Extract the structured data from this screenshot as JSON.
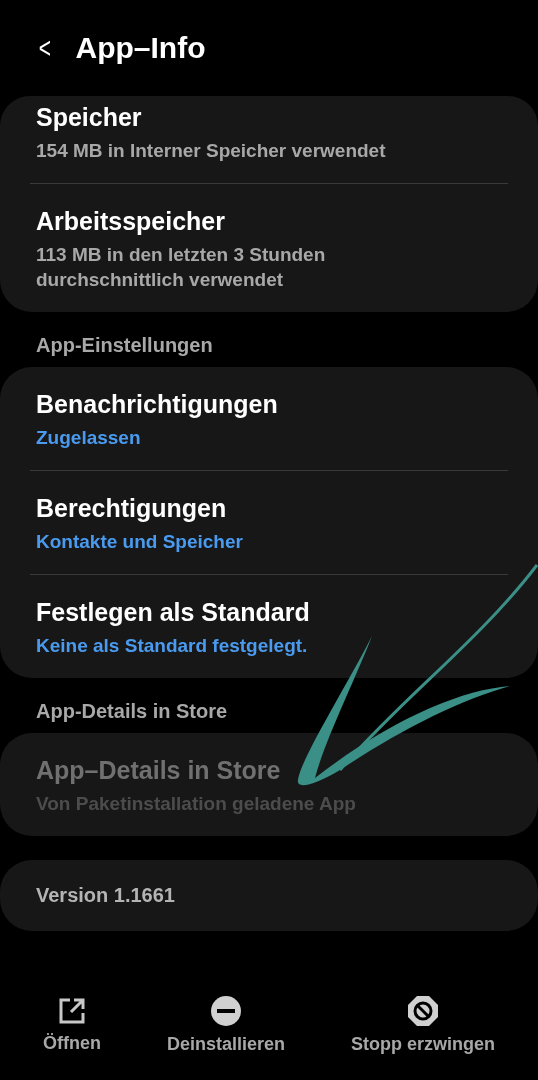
{
  "header": {
    "back": "<",
    "title": "App–Info"
  },
  "groups": [
    {
      "items": [
        {
          "title": "Speicher",
          "summary": [
            "154 MB in Interner Speicher verwendet"
          ],
          "kind": "info",
          "disabled": false
        },
        {
          "title": "Arbeitsspeicher",
          "summary": [
            "113 MB in den letzten 3 Stunden",
            "durchschnittlich verwendet"
          ],
          "kind": "info",
          "disabled": false
        }
      ]
    },
    {
      "heading": "App-Einstellungen",
      "items": [
        {
          "title": "Benachrichtigungen",
          "summary": [
            "Zugelassen"
          ],
          "kind": "setting",
          "disabled": false
        },
        {
          "title": "Berechtigungen",
          "summary": [
            "Kontakte und Speicher"
          ],
          "kind": "setting",
          "disabled": false
        },
        {
          "title": "Festlegen als Standard",
          "summary": [
            "Keine als Standard festgelegt."
          ],
          "kind": "setting",
          "disabled": false
        }
      ]
    },
    {
      "heading": "App-Details in Store",
      "items": [
        {
          "title": "App–Details in Store",
          "summary": [
            "Von Paketinstallation geladene App"
          ],
          "kind": "info",
          "disabled": true
        }
      ]
    }
  ],
  "version": "Version 1.1661",
  "actions": [
    {
      "label": "Öffnen",
      "kind": "open"
    },
    {
      "label": "Deinstallieren",
      "kind": "uninstall"
    },
    {
      "label": "Stopp erzwingen",
      "kind": "stop"
    }
  ]
}
